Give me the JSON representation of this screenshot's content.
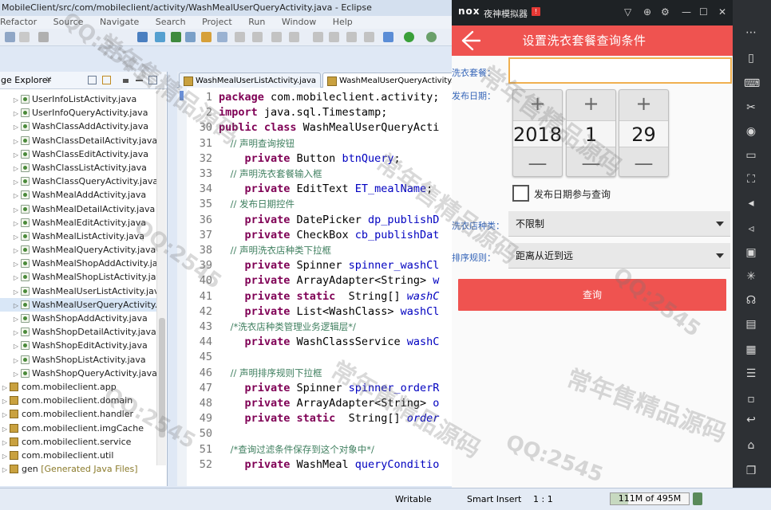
{
  "eclipse": {
    "title": "MobileClient/src/com/mobileclient/activity/WashMealUserQueryActivity.java - Eclipse",
    "menu": [
      "Refactor",
      "Source",
      "Navigate",
      "Search",
      "Project",
      "Run",
      "Window",
      "Help"
    ],
    "package_explorer": {
      "title": "ge Explorer",
      "close": "✕",
      "items": [
        {
          "label": "UserInfoListActivity.java",
          "kind": "file"
        },
        {
          "label": "UserInfoQueryActivity.java",
          "kind": "file"
        },
        {
          "label": "WashClassAddActivity.java",
          "kind": "file"
        },
        {
          "label": "WashClassDetailActivity.java",
          "kind": "file"
        },
        {
          "label": "WashClassEditActivity.java",
          "kind": "file"
        },
        {
          "label": "WashClassListActivity.java",
          "kind": "file"
        },
        {
          "label": "WashClassQueryActivity.java",
          "kind": "file"
        },
        {
          "label": "WashMealAddActivity.java",
          "kind": "file"
        },
        {
          "label": "WashMealDetailActivity.java",
          "kind": "file"
        },
        {
          "label": "WashMealEditActivity.java",
          "kind": "file"
        },
        {
          "label": "WashMealListActivity.java",
          "kind": "file"
        },
        {
          "label": "WashMealQueryActivity.java",
          "kind": "file"
        },
        {
          "label": "WashMealShopAddActivity.jav",
          "kind": "file"
        },
        {
          "label": "WashMealShopListActivity.java",
          "kind": "file"
        },
        {
          "label": "WashMealUserListActivity.java",
          "kind": "file"
        },
        {
          "label": "WashMealUserQueryActivity.ja",
          "kind": "file",
          "selected": true
        },
        {
          "label": "WashShopAddActivity.java",
          "kind": "file"
        },
        {
          "label": "WashShopDetailActivity.java",
          "kind": "file"
        },
        {
          "label": "WashShopEditActivity.java",
          "kind": "file"
        },
        {
          "label": "WashShopListActivity.java",
          "kind": "file"
        },
        {
          "label": "WashShopQueryActivity.java",
          "kind": "file"
        },
        {
          "label": "com.mobileclient.app",
          "kind": "package"
        },
        {
          "label": "com.mobileclient.domain",
          "kind": "package"
        },
        {
          "label": "com.mobileclient.handler",
          "kind": "package"
        },
        {
          "label": "com.mobileclient.imgCache",
          "kind": "package"
        },
        {
          "label": "com.mobileclient.service",
          "kind": "package"
        },
        {
          "label": "com.mobileclient.util",
          "kind": "package"
        },
        {
          "label": "gen",
          "kind": "package",
          "annotation": "[Generated Java Files]"
        }
      ]
    },
    "editor_tabs": [
      {
        "label": "WashMealUserListActivity.java",
        "active": false
      },
      {
        "label": "WashMealUserQueryActivity.java",
        "active": true
      }
    ],
    "code_lines": [
      {
        "n": "1",
        "parts": [
          [
            "kw",
            "package "
          ],
          [
            "",
            "com.mobileclient.activity;"
          ]
        ]
      },
      {
        "n": "2",
        "parts": [
          [
            "kw",
            "import "
          ],
          [
            "",
            "java.sql.Timestamp;"
          ]
        ]
      },
      {
        "n": "30",
        "parts": [
          [
            "kw",
            "public class "
          ],
          [
            "",
            "WashMealUserQueryActi"
          ]
        ]
      },
      {
        "n": "31",
        "parts": [
          [
            "cm",
            "    // 声明查询按钮"
          ]
        ]
      },
      {
        "n": "32",
        "parts": [
          [
            "kw",
            "    private "
          ],
          [
            "",
            "Button "
          ],
          [
            "fd",
            "btnQuery"
          ],
          [
            "",
            ";"
          ]
        ]
      },
      {
        "n": "33",
        "parts": [
          [
            "cm",
            "    // 声明洗衣套餐输入框"
          ]
        ]
      },
      {
        "n": "34",
        "parts": [
          [
            "kw",
            "    private "
          ],
          [
            "",
            "EditText "
          ],
          [
            "fd",
            "ET_mealName"
          ],
          [
            "",
            ";"
          ]
        ]
      },
      {
        "n": "35",
        "parts": [
          [
            "cm",
            "    // 发布日期控件"
          ]
        ]
      },
      {
        "n": "36",
        "parts": [
          [
            "kw",
            "    private "
          ],
          [
            "",
            "DatePicker "
          ],
          [
            "fd",
            "dp_publishD"
          ]
        ]
      },
      {
        "n": "37",
        "parts": [
          [
            "kw",
            "    private "
          ],
          [
            "",
            "CheckBox "
          ],
          [
            "fd",
            "cb_publishDat"
          ]
        ]
      },
      {
        "n": "38",
        "parts": [
          [
            "cm",
            "    // 声明洗衣店种类下拉框"
          ]
        ]
      },
      {
        "n": "39",
        "parts": [
          [
            "kw",
            "    private "
          ],
          [
            "",
            "Spinner "
          ],
          [
            "fd",
            "spinner_washCl"
          ]
        ]
      },
      {
        "n": "40",
        "parts": [
          [
            "kw",
            "    private "
          ],
          [
            "",
            "ArrayAdapter<String> "
          ],
          [
            "fd",
            "w"
          ]
        ]
      },
      {
        "n": "41",
        "parts": [
          [
            "kw",
            "    private static  "
          ],
          [
            "",
            "String[] "
          ],
          [
            "fdi",
            "washC"
          ]
        ]
      },
      {
        "n": "42",
        "parts": [
          [
            "kw",
            "    private "
          ],
          [
            "",
            "List<WashClass> "
          ],
          [
            "fd",
            "washCl"
          ]
        ]
      },
      {
        "n": "43",
        "parts": [
          [
            "cm",
            "    /*洗衣店种类管理业务逻辑层*/"
          ]
        ]
      },
      {
        "n": "44",
        "parts": [
          [
            "kw",
            "    private "
          ],
          [
            "",
            "WashClassService "
          ],
          [
            "fd",
            "washC"
          ]
        ]
      },
      {
        "n": "45",
        "parts": []
      },
      {
        "n": "46",
        "parts": [
          [
            "cm",
            "    // 声明排序规则下拉框"
          ]
        ]
      },
      {
        "n": "47",
        "parts": [
          [
            "kw",
            "    private "
          ],
          [
            "",
            "Spinner "
          ],
          [
            "fd",
            "spinner_orderR"
          ]
        ]
      },
      {
        "n": "48",
        "parts": [
          [
            "kw",
            "    private "
          ],
          [
            "",
            "ArrayAdapter<String> "
          ],
          [
            "fd",
            "o"
          ]
        ]
      },
      {
        "n": "49",
        "parts": [
          [
            "kw",
            "    private static  "
          ],
          [
            "",
            "String[] "
          ],
          [
            "fdi",
            "order"
          ]
        ]
      },
      {
        "n": "50",
        "parts": []
      },
      {
        "n": "51",
        "parts": [
          [
            "cm",
            "    /*查询过滤条件保存到这个对象中*/"
          ]
        ]
      },
      {
        "n": "52",
        "parts": [
          [
            "kw",
            "    private "
          ],
          [
            "",
            "WashMeal "
          ],
          [
            "fd",
            "queryConditio"
          ]
        ]
      }
    ],
    "status": {
      "writable": "Writable",
      "insert_mode": "Smart Insert",
      "position": "1 : 1",
      "memory": "111M of 495M",
      "memory_fraction": 0.224
    }
  },
  "nox": {
    "logo": "nox",
    "name": "夜神模拟器",
    "badge": "!",
    "controls": [
      "▽",
      "⊕",
      "⚙",
      "—",
      "☐",
      "✕"
    ]
  },
  "app": {
    "title": "设置洗衣套餐查询条件",
    "meal_label": "洗衣套餐：",
    "meal_value": "",
    "publish_label": "发布日期：",
    "date": {
      "year": "2018",
      "month": "1",
      "day": "29",
      "plus": "+",
      "minus": "—"
    },
    "publish_checkbox": "发布日期参与查询",
    "shop_type_label": "洗衣店种类：",
    "shop_type_value": "不限制",
    "order_label": "排序规则：",
    "order_value": "距离从近到远",
    "query_button": "查询"
  },
  "watermarks": [
    "常年售精品源码",
    "QQ:2545"
  ]
}
